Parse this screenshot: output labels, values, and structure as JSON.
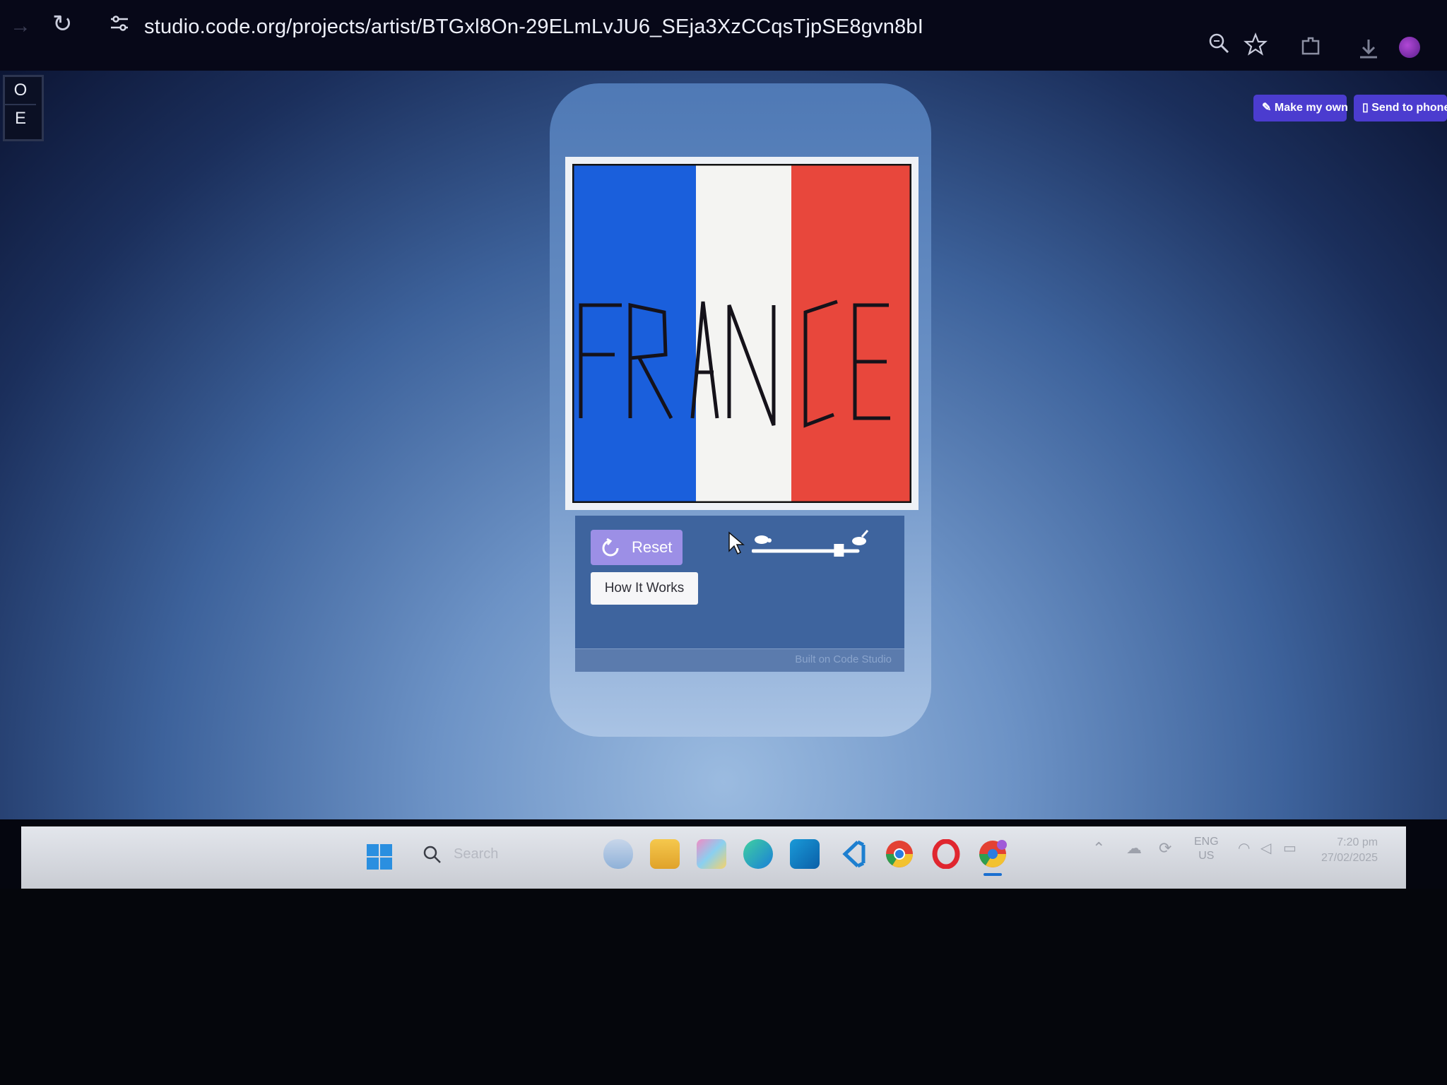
{
  "browser": {
    "url": "studio.code.org/projects/artist/BTGxl8On-29ELmLvJU6_SEja3XzCCqsTjpSE8gvn8bI",
    "icons": [
      "back-arrow-icon",
      "reload-icon",
      "site-info-icon",
      "zoom-icon",
      "star-icon",
      "extensions-icon",
      "download-icon"
    ]
  },
  "side_panel": {
    "keys": [
      "O",
      "E"
    ]
  },
  "header_buttons": {
    "make_my_own": "Make my own",
    "send_to_phone": "Send to phone"
  },
  "canvas": {
    "word": "FRANCE",
    "flag_colors": {
      "blue": "#1a5fdc",
      "white": "#f4f4f2",
      "red": "#e8473c"
    }
  },
  "controls": {
    "reset_label": "Reset",
    "how_it_works_label": "How It Works",
    "speed_slider_level": 0.82
  },
  "footer": {
    "built_on": "Built on Code Studio"
  },
  "taskbar": {
    "search_placeholder": "Search",
    "language_line1": "ENG",
    "language_line2": "US",
    "time": "7:20 pm",
    "date": "27/02/2025"
  }
}
